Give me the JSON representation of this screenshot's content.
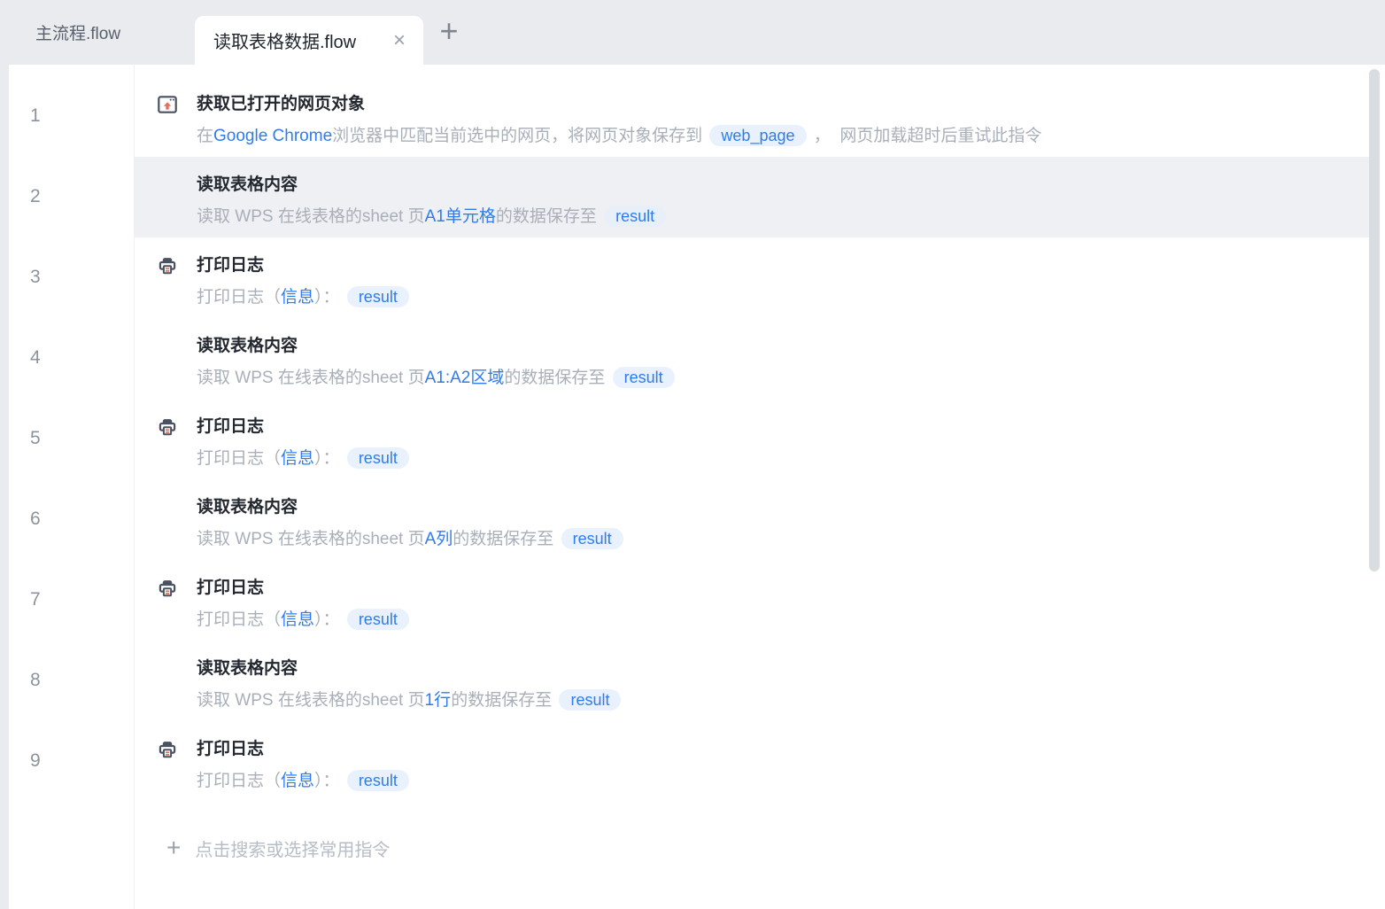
{
  "tab_bar": {
    "tabs": [
      {
        "label": "主流程.flow",
        "active": false
      },
      {
        "label": "读取表格数据.flow",
        "active": true
      }
    ],
    "close_label": "×",
    "new_tab_label": "+"
  },
  "steps": [
    {
      "num": "1",
      "icon": "browser-window",
      "title": "获取已打开的网页对象",
      "selected": false,
      "desc": [
        {
          "t": "在",
          "s": "gray"
        },
        {
          "t": "Google Chrome",
          "s": "blue"
        },
        {
          "t": "浏览器中匹配当前选中的网页，将网页对象保存到 ",
          "s": "gray"
        },
        {
          "t": "web_page",
          "s": "pill"
        },
        {
          "t": " ，  网页加载超时后重试此指令",
          "s": "gray"
        }
      ]
    },
    {
      "num": "2",
      "icon": "none",
      "title": "读取表格内容",
      "selected": true,
      "desc": [
        {
          "t": "读取 WPS 在线表格的sheet 页",
          "s": "gray"
        },
        {
          "t": "A1单元格",
          "s": "blue"
        },
        {
          "t": "的数据保存至 ",
          "s": "gray"
        },
        {
          "t": "result",
          "s": "pill"
        }
      ]
    },
    {
      "num": "3",
      "icon": "printer",
      "title": "打印日志",
      "selected": false,
      "desc": [
        {
          "t": "打印日志（",
          "s": "gray"
        },
        {
          "t": "信息",
          "s": "blue"
        },
        {
          "t": "）： ",
          "s": "gray"
        },
        {
          "t": "result",
          "s": "pill"
        }
      ]
    },
    {
      "num": "4",
      "icon": "none",
      "title": "读取表格内容",
      "selected": false,
      "desc": [
        {
          "t": "读取 WPS 在线表格的sheet 页",
          "s": "gray"
        },
        {
          "t": "A1:A2区域",
          "s": "blue"
        },
        {
          "t": "的数据保存至 ",
          "s": "gray"
        },
        {
          "t": "result",
          "s": "pill"
        }
      ]
    },
    {
      "num": "5",
      "icon": "printer",
      "title": "打印日志",
      "selected": false,
      "desc": [
        {
          "t": "打印日志（",
          "s": "gray"
        },
        {
          "t": "信息",
          "s": "blue"
        },
        {
          "t": "）： ",
          "s": "gray"
        },
        {
          "t": "result",
          "s": "pill"
        }
      ]
    },
    {
      "num": "6",
      "icon": "none",
      "title": "读取表格内容",
      "selected": false,
      "desc": [
        {
          "t": "读取 WPS 在线表格的sheet 页",
          "s": "gray"
        },
        {
          "t": "A列",
          "s": "blue"
        },
        {
          "t": "的数据保存至 ",
          "s": "gray"
        },
        {
          "t": "result",
          "s": "pill"
        }
      ]
    },
    {
      "num": "7",
      "icon": "printer",
      "title": "打印日志",
      "selected": false,
      "desc": [
        {
          "t": "打印日志（",
          "s": "gray"
        },
        {
          "t": "信息",
          "s": "blue"
        },
        {
          "t": "）： ",
          "s": "gray"
        },
        {
          "t": "result",
          "s": "pill"
        }
      ]
    },
    {
      "num": "8",
      "icon": "none",
      "title": "读取表格内容",
      "selected": false,
      "desc": [
        {
          "t": "读取 WPS 在线表格的sheet 页",
          "s": "gray"
        },
        {
          "t": "1行",
          "s": "blue"
        },
        {
          "t": "的数据保存至 ",
          "s": "gray"
        },
        {
          "t": "result",
          "s": "pill"
        }
      ]
    },
    {
      "num": "9",
      "icon": "printer",
      "title": "打印日志",
      "selected": false,
      "desc": [
        {
          "t": "打印日志（",
          "s": "gray"
        },
        {
          "t": "信息",
          "s": "blue"
        },
        {
          "t": "）： ",
          "s": "gray"
        },
        {
          "t": "result",
          "s": "pill"
        }
      ]
    }
  ],
  "add_row": {
    "plus": "+",
    "label": "点击搜索或选择常用指令"
  },
  "colors": {
    "accent_blue": "#2e7cf0",
    "pill_background": "#e9f1fd",
    "selected_row_background": "#eef0f4",
    "icon_dark": "#4a5160",
    "icon_red": "#ec6a5e",
    "tab_bar_background": "#e9ebee",
    "description_gray": "#a9afb9",
    "title_dark": "#23272f"
  }
}
